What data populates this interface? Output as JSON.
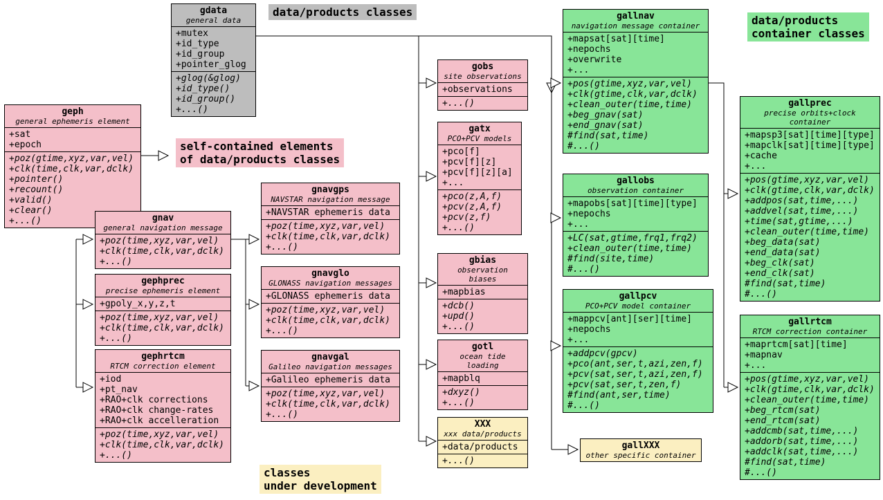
{
  "labels": {
    "dataproducts": "data/products classes",
    "selfcontained": "self-contained elements\nof data/products classes",
    "underdev": "classes\nunder development",
    "containers": "data/products\ncontainer classes"
  },
  "gdata": {
    "name": "gdata",
    "desc": "general data",
    "attrs": "+mutex\n+id_type\n+id_group\n+pointer_glog",
    "methods": "+glog(&glog)\n+id_type()\n+id_group()\n+...()"
  },
  "geph": {
    "name": "geph",
    "desc": "general ephemeris element",
    "attrs": "+sat\n+epoch",
    "methods": "+poz(gtime,xyz,var,vel)\n+clk(time,clk,var,dclk)\n+pointer()\n+recount()\n+valid()\n+clear()\n+...()"
  },
  "gnav": {
    "name": "gnav",
    "desc": "general navigation message",
    "methods": "+poz(time,xyz,var,vel)\n+clk(time,clk,var,dclk)\n+...()"
  },
  "gephprec": {
    "name": "gephprec",
    "desc": "precise ephemeris element",
    "attrs": "+gpoly_x,y,z,t",
    "methods": "+poz(time,xyz,var,vel)\n+clk(time,clk,var,dclk)\n+...()"
  },
  "gephrtcm": {
    "name": "gephrtcm",
    "desc": "RTCM correction element",
    "attrs": "+iod\n+pt_nav\n+RAO+clk corrections\n+RAO+clk change-rates\n+RAO+clk accelleration",
    "methods": "+poz(time,xyz,var,vel)\n+clk(time,clk,var,dclk)\n+...()"
  },
  "gnavgps": {
    "name": "gnavgps",
    "desc": "NAVSTAR navigation message",
    "attrs": "+NAVSTAR ephemeris data",
    "methods": "+poz(time,xyz,var,vel)\n+clk(time,clk,var,dclk)\n+...()"
  },
  "gnavglo": {
    "name": "gnavglo",
    "desc": "GLONASS navigation messages",
    "attrs": "+GLONASS ephemeris data",
    "methods": "+poz(time,xyz,var,vel)\n+clk(time,clk,var,dclk)\n+...()"
  },
  "gnavgal": {
    "name": "gnavgal",
    "desc": "Galileo navigation messages",
    "attrs": "+Galileo ephemeris data",
    "methods": "+poz(time,xyz,var,vel)\n+clk(time,clk,var,dclk)\n+...()"
  },
  "gobs": {
    "name": "gobs",
    "desc": "site observations",
    "attrs": "+observations",
    "methods": "+...()"
  },
  "gatx": {
    "name": "gatx",
    "desc": "PCO+PCV models",
    "attrs": "+pco[f]\n+pcv[f][z]\n+pcv[f][z][a]\n+...",
    "methods": "+pco(z,A,f)\n+pcv(z,A,f)\n+pcv(z,f)\n+...()"
  },
  "gbias": {
    "name": "gbias",
    "desc": "observation biases",
    "attrs": "+mapbias",
    "methods": "+dcb()\n+upd()\n+...()"
  },
  "gotl": {
    "name": "gotl",
    "desc": "ocean tide loading",
    "attrs": "+mapblq",
    "methods": "+dxyz()\n+...()"
  },
  "xxx": {
    "name": "XXX",
    "desc": "xxx data/products",
    "attrs": "+data/products",
    "methods": "+...()"
  },
  "gallnav": {
    "name": "gallnav",
    "desc": "navigation message container",
    "attrs": "+mapsat[sat][time]\n+nepochs\n+overwrite\n+...",
    "methods": "+pos(gtime,xyz,var,vel)\n+clk(gtime,clk,var,dclk)\n+clean_outer(time,time)\n+beg_gnav(sat)\n+end_gnav(sat)\n#find(sat,time)\n#...()"
  },
  "gallobs": {
    "name": "gallobs",
    "desc": "observation container",
    "attrs": "+mapobs[sat][time][type]\n+nepochs\n+...",
    "methods": "+LC(sat,gtime,frq1,frq2)\n+clean_outer(time,time)\n#find(site,time)\n#...()"
  },
  "gallpcv": {
    "name": "gallpcv",
    "desc": "PCO+PCV model container",
    "attrs": "+mappcv[ant][ser][time]\n+nepochs\n+...",
    "methods": "+addpcv(gpcv)\n+pco(ant,ser,t,azi,zen,f)\n+pcv(sat,ser,t,azi,zen,f)\n+pcv(sat,ser,t,zen,f)\n#find(ant,ser,time)\n#...()"
  },
  "gallxxx": {
    "name": "gallXXX",
    "desc": "other specific container"
  },
  "gallprec": {
    "name": "gallprec",
    "desc": "precise orbits+clock container",
    "attrs": "+mapsp3[sat][time][type]\n+mapclk[sat][time][type]\n+cache\n+...",
    "methods": "+pos(gtime,xyz,var,vel)\n+clk(gtime,clk,var,dclk)\n+addpos(sat,time,...)\n+addvel(sat,time,...)\n+time(sat,gtime,...)\n+clean_outer(time,time)\n+beg_data(sat)\n+end_data(sat)\n+beg_clk(sat)\n+end_clk(sat)\n#find(sat,time)\n#...()"
  },
  "gallrtcm": {
    "name": "gallrtcm",
    "desc": "RTCM correction container",
    "attrs": "+maprtcm[sat][time]\n+mapnav\n+...",
    "methods": "+pos(gtime,xyz,var,vel)\n+clk(gtime,clk,var,dclk)\n+clean_outer(time,time)\n+beg_rtcm(sat)\n+end_rtcm(sat)\n+addcmb(sat,time,...)\n+addorb(sat,time,...)\n+addclk(sat,time,...)\n#find(sat,time)\n#...()"
  }
}
